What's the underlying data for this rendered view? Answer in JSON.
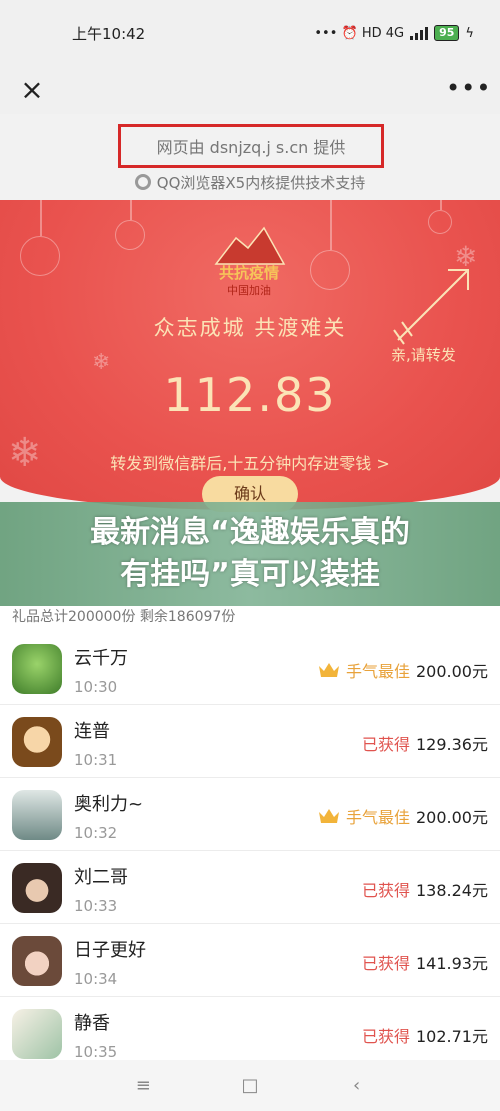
{
  "status_bar": {
    "time": "上午10:42",
    "icons_text": "••• ⏰ HD 4G",
    "battery": "95"
  },
  "top_bar": {
    "close_icon": "×",
    "more_icon": "•••"
  },
  "provider": {
    "text": "网页由 dsnjzq.j  s.cn 提供",
    "engine": "QQ浏览器X5内核提供技术支持"
  },
  "red_packet": {
    "logo_top": "共抗疫情",
    "logo_bottom": "中国加油",
    "slogan": "众志成城 共渡难关",
    "amount": "112.83",
    "share_label": "亲,请转发",
    "hint": "转发到微信群后,十五分钟内存进零钱 >",
    "confirm": "确认"
  },
  "overlay": {
    "line1": "最新消息“逸趣娱乐真的",
    "line2": "有挂吗”真可以装挂"
  },
  "list": {
    "summary": "礼品总计200000份 剩余186097份",
    "rows": [
      {
        "name": "云千万",
        "time": "10:30",
        "badge": "手气最佳",
        "amount": "200.00元",
        "best": true
      },
      {
        "name": "连普",
        "time": "10:31",
        "badge": "已获得",
        "amount": "129.36元",
        "best": false
      },
      {
        "name": "奥利力~",
        "time": "10:32",
        "badge": "手气最佳",
        "amount": "200.00元",
        "best": true
      },
      {
        "name": "刘二哥",
        "time": "10:33",
        "badge": "已获得",
        "amount": "138.24元",
        "best": false
      },
      {
        "name": "日子更好",
        "time": "10:34",
        "badge": "已获得",
        "amount": "141.93元",
        "best": false
      },
      {
        "name": "静香",
        "time": "10:35",
        "badge": "已获得",
        "amount": "102.71元",
        "best": false
      }
    ]
  },
  "nav": {
    "menu": "≡",
    "home": "□",
    "back": "‹"
  },
  "colors": {
    "red": "#e9524e",
    "gold": "#fbe3b6",
    "best": "#e8a23a",
    "got": "#e0544f"
  }
}
